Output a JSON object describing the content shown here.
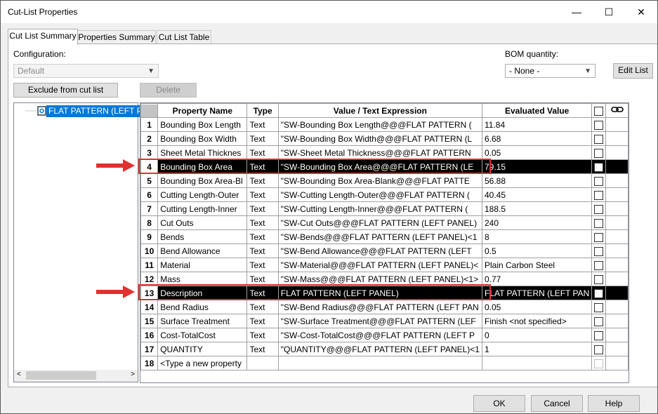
{
  "window": {
    "title": "Cut-List Properties",
    "minimize": "—",
    "maximize": "☐",
    "close": "✕"
  },
  "tabs": [
    "Cut List Summary",
    "Properties Summary",
    "Cut List Table"
  ],
  "configuration": {
    "label": "Configuration:",
    "value": "Default"
  },
  "bom": {
    "label": "BOM quantity:",
    "value": "- None -"
  },
  "buttons": {
    "exclude": "Exclude from cut list",
    "delete": "Delete",
    "edit_list": "Edit List",
    "ok": "OK",
    "cancel": "Cancel",
    "help": "Help"
  },
  "tree": {
    "item": "FLAT PATTERN (LEFT PAN"
  },
  "grid": {
    "headers": [
      "Property Name",
      "Type",
      "Value / Text Expression",
      "Evaluated Value"
    ],
    "rows": [
      {
        "n": "1",
        "name": "Bounding Box Length",
        "type": "Text",
        "expr": "\"SW-Bounding Box Length@@@FLAT PATTERN (",
        "value": "11.84"
      },
      {
        "n": "2",
        "name": "Bounding Box Width",
        "type": "Text",
        "expr": "\"SW-Bounding Box Width@@@FLAT PATTERN (L",
        "value": "6.68"
      },
      {
        "n": "3",
        "name": "Sheet Metal Thicknes",
        "type": "Text",
        "expr": "\"SW-Sheet Metal Thickness@@@FLAT PATTERN",
        "value": "0.05"
      },
      {
        "n": "4",
        "name": "Bounding Box Area",
        "type": "Text",
        "expr": "\"SW-Bounding Box Area@@@FLAT PATTERN (LE",
        "value": "79.15"
      },
      {
        "n": "5",
        "name": "Bounding Box Area-Bl",
        "type": "Text",
        "expr": "\"SW-Bounding Box Area-Blank@@@FLAT PATTE",
        "value": "56.88"
      },
      {
        "n": "6",
        "name": "Cutting Length-Outer",
        "type": "Text",
        "expr": "\"SW-Cutting Length-Outer@@@FLAT PATTERN (",
        "value": "40.45"
      },
      {
        "n": "7",
        "name": "Cutting Length-Inner",
        "type": "Text",
        "expr": "\"SW-Cutting Length-Inner@@@FLAT PATTERN (",
        "value": "188.5"
      },
      {
        "n": "8",
        "name": "Cut Outs",
        "type": "Text",
        "expr": "\"SW-Cut Outs@@@FLAT PATTERN (LEFT PANEL)",
        "value": "240"
      },
      {
        "n": "9",
        "name": "Bends",
        "type": "Text",
        "expr": "\"SW-Bends@@@FLAT PATTERN (LEFT PANEL)<1",
        "value": "8"
      },
      {
        "n": "10",
        "name": "Bend Allowance",
        "type": "Text",
        "expr": "\"SW-Bend Allowance@@@FLAT PATTERN (LEFT",
        "value": "0.5"
      },
      {
        "n": "11",
        "name": "Material",
        "type": "Text",
        "expr": "\"SW-Material@@@FLAT PATTERN (LEFT PANEL)<",
        "value": "Plain Carbon Steel"
      },
      {
        "n": "12",
        "name": "Mass",
        "type": "Text",
        "expr": "\"SW-Mass@@@FLAT PATTERN (LEFT PANEL)<1>",
        "value": "0.77"
      },
      {
        "n": "13",
        "name": "Description",
        "type": "Text",
        "expr": "FLAT PATTERN (LEFT PANEL)",
        "value": "FLAT PATTERN (LEFT PAN"
      },
      {
        "n": "14",
        "name": "Bend Radius",
        "type": "Text",
        "expr": "\"SW-Bend Radius@@@FLAT PATTERN (LEFT PAN",
        "value": "0.05"
      },
      {
        "n": "15",
        "name": "Surface Treatment",
        "type": "Text",
        "expr": "\"SW-Surface Treatment@@@FLAT PATTERN (LEF",
        "value": "Finish <not specified>"
      },
      {
        "n": "16",
        "name": "Cost-TotalCost",
        "type": "Text",
        "expr": "\"SW-Cost-TotalCost@@@FLAT PATTERN (LEFT P",
        "value": "0"
      },
      {
        "n": "17",
        "name": "QUANTITY",
        "type": "Text",
        "expr": "\"QUANTITY@@@FLAT PATTERN (LEFT PANEL)<1",
        "value": "1"
      },
      {
        "n": "18",
        "name": "<Type a new property",
        "type": "",
        "expr": "",
        "value": ""
      }
    ]
  },
  "colors": {
    "highlight": "#000000",
    "annotation": "#e03030",
    "selection": "#0078d7"
  }
}
